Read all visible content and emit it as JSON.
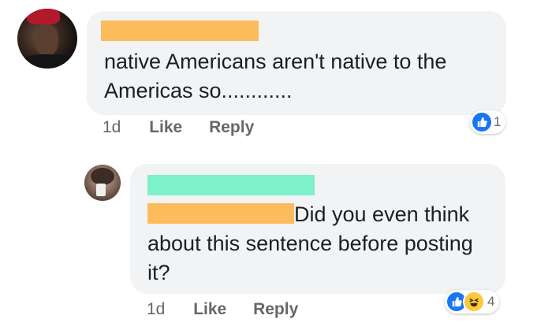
{
  "comments": [
    {
      "text": "native Americans aren't native to the Americas so............",
      "time": "1d",
      "like_label": "Like",
      "reply_label": "Reply",
      "reactions": {
        "icons": [
          "like-icon"
        ],
        "count": "1"
      }
    },
    {
      "text": "Did you even think about this sentence before posting it?",
      "time": "1d",
      "like_label": "Like",
      "reply_label": "Reply",
      "reactions": {
        "icons": [
          "like-icon",
          "haha-icon"
        ],
        "count": "4"
      }
    }
  ],
  "colors": {
    "bubble": "#f2f3f5",
    "redact_orange": "#fdbc5c",
    "redact_green": "#7cf1ca",
    "like_blue": "#1877f2",
    "haha_yellow": "#fcc93a"
  }
}
